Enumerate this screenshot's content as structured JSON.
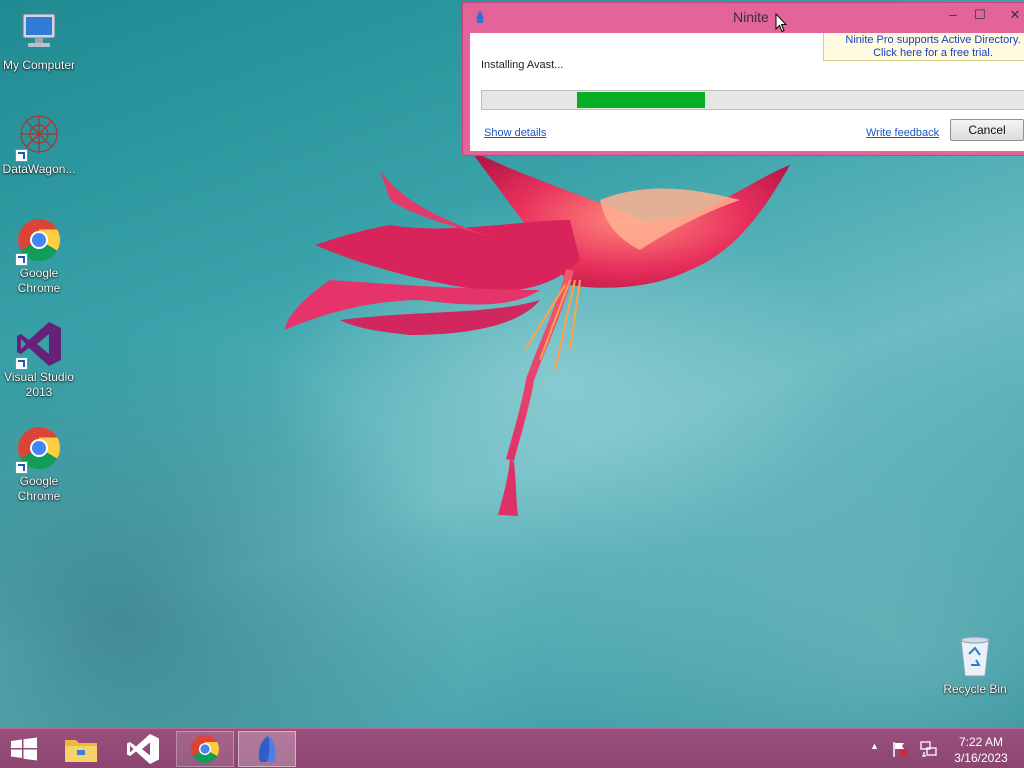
{
  "desktop": {
    "icons": [
      {
        "label": "My Computer",
        "icon": "computer-icon"
      },
      {
        "label": "DataWagon...",
        "icon": "datawagon-icon"
      },
      {
        "label": "Google Chrome",
        "icon": "chrome-icon"
      },
      {
        "label": "Visual Studio 2013",
        "icon": "visual-studio-icon"
      },
      {
        "label": "Google Chrome",
        "icon": "chrome-icon"
      }
    ],
    "recycle_bin": {
      "label": "Recycle Bin",
      "icon": "recycle-bin-icon"
    }
  },
  "ninite": {
    "title": "Ninite",
    "minimize": "–",
    "maximize": "☐",
    "close": "✕",
    "ad_line1": "Ninite Pro supports Active Directory.",
    "ad_line2": "Click here for a free trial.",
    "status": "Installing Avast...",
    "progress": {
      "fill_start": 0.17,
      "fill_end": 0.4
    },
    "show_details": "Show details",
    "write_feedback": "Write feedback",
    "cancel": "Cancel"
  },
  "taskbar": {
    "start_icon": "windows-start-icon",
    "apps": [
      "file-explorer-icon",
      "visual-studio-icon",
      "chrome-icon",
      "ninite-icon"
    ],
    "tray": {
      "chevron": "▲"
    },
    "time": "7:22 AM",
    "date": "3/16/2023"
  },
  "colors": {
    "window_frame": "#e4649a",
    "taskbar": "#8c4571",
    "progress_fill": "#06b025",
    "link": "#1a56c4"
  }
}
